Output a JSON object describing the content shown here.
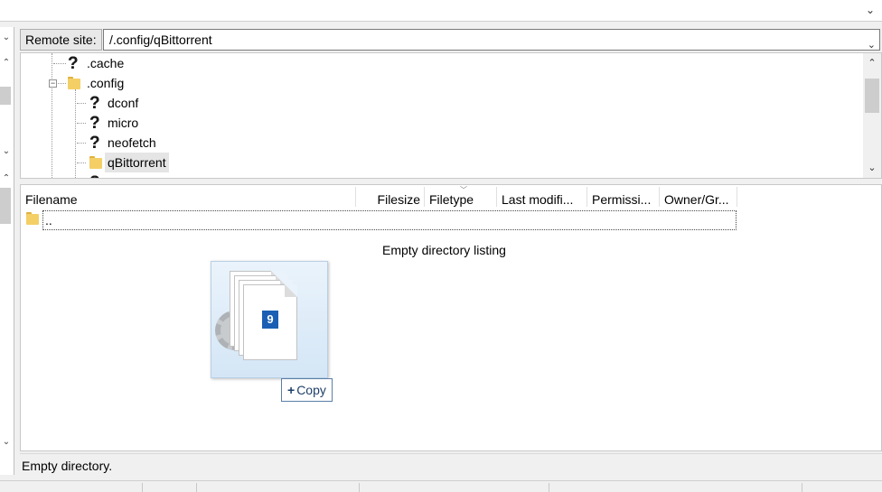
{
  "remote_site": {
    "label": "Remote site:",
    "path": "/.config/qBittorrent"
  },
  "tree": {
    "items": [
      {
        "label": ".cache",
        "icon": "question-icon",
        "depth": 1
      },
      {
        "label": ".config",
        "icon": "folder-icon",
        "depth": 1,
        "expanded": true
      },
      {
        "label": "dconf",
        "icon": "question-icon",
        "depth": 2
      },
      {
        "label": "micro",
        "icon": "question-icon",
        "depth": 2
      },
      {
        "label": "neofetch",
        "icon": "question-icon",
        "depth": 2
      },
      {
        "label": "qBittorrent",
        "icon": "folder-icon",
        "depth": 2,
        "selected": true
      }
    ],
    "expander_symbol": "−"
  },
  "list": {
    "columns": [
      "Filename",
      "Filesize",
      "Filetype",
      "Last modifi...",
      "Permissi...",
      "Owner/Gr..."
    ],
    "parent_row": "..",
    "empty_text": "Empty directory listing"
  },
  "drag": {
    "count": "9",
    "action_label": "Copy",
    "action_symbol": "+"
  },
  "status": {
    "text": "Empty directory."
  },
  "icons": {
    "chevron_down": "⌄",
    "arrow_up": "⌃",
    "arrow_down": "⌄"
  },
  "colors": {
    "accent": "#1a5fb4",
    "folder": "#f4cf66",
    "question": "#f7cf4a"
  }
}
